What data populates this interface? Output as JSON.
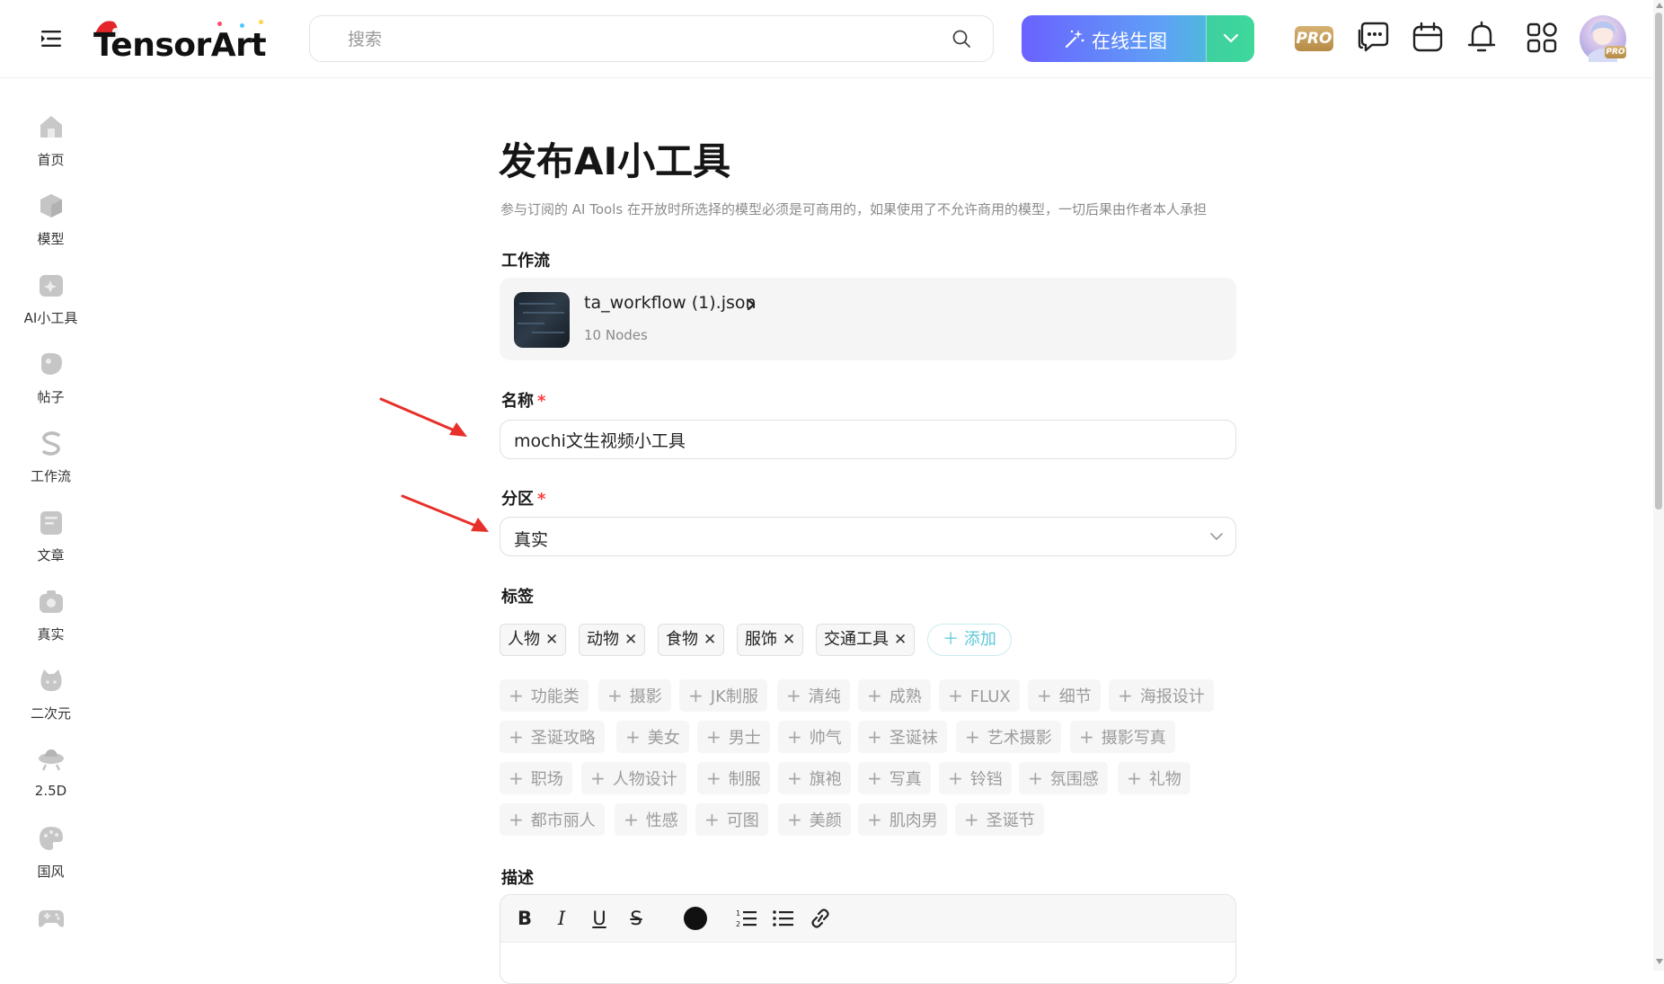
{
  "header": {
    "logo_text": "TensorArt",
    "search_placeholder": "搜索",
    "generate_label": "在线生图",
    "pro_label": "PRO",
    "avatar_pro_label": "PRO"
  },
  "sidebar": {
    "items": [
      {
        "label": "首页",
        "icon": "home-icon"
      },
      {
        "label": "模型",
        "icon": "cube-icon"
      },
      {
        "label": "AI小工具",
        "icon": "ai-tools-icon"
      },
      {
        "label": "帖子",
        "icon": "post-icon"
      },
      {
        "label": "工作流",
        "icon": "workflow-icon"
      },
      {
        "label": "文章",
        "icon": "article-icon"
      },
      {
        "label": "真实",
        "icon": "camera-icon"
      },
      {
        "label": "二次元",
        "icon": "anime-icon"
      },
      {
        "label": "2.5D",
        "icon": "ufo-icon"
      },
      {
        "label": "国风",
        "icon": "palette-icon"
      },
      {
        "label": "",
        "icon": "gamepad-icon"
      }
    ]
  },
  "page": {
    "title": "发布AI小工具",
    "subtitle": "参与订阅的 AI Tools 在开放时所选择的模型必须是可商用的，如果使用了不允许商用的模型，一切后果由作者本人承担"
  },
  "workflow": {
    "label": "工作流",
    "file_name": "ta_workflow (1).json",
    "nodes": "10 Nodes"
  },
  "name_field": {
    "label": "名称",
    "required": "*",
    "value": "mochi文生视频小工具"
  },
  "category_field": {
    "label": "分区",
    "required": "*",
    "value": "真实"
  },
  "tags": {
    "label": "标签",
    "selected": [
      "人物",
      "动物",
      "食物",
      "服饰",
      "交通工具"
    ],
    "add_label": "添加",
    "suggestions": [
      [
        "功能类",
        "摄影",
        "JK制服",
        "清纯",
        "成熟",
        "FLUX",
        "细节",
        "海报设计"
      ],
      [
        "圣诞攻略",
        "美女",
        "男士",
        "帅气",
        "圣诞袜",
        "艺术摄影",
        "摄影写真"
      ],
      [
        "职场",
        "人物设计",
        "制服",
        "旗袍",
        "写真",
        "铃铛",
        "氛围感",
        "礼物"
      ],
      [
        "都市丽人",
        "性感",
        "可图",
        "美颜",
        "肌肉男",
        "圣诞节"
      ]
    ]
  },
  "description": {
    "label": "描述",
    "toolbar": [
      "bold-icon",
      "italic-icon",
      "underline-icon",
      "strikethrough-icon",
      "text-color-icon",
      "ordered-list-icon",
      "bullet-list-icon",
      "link-icon"
    ]
  },
  "colors": {
    "accent_start": "#6a62ff",
    "accent_end": "#3ed2c2",
    "required": "#ff3b3b",
    "annotation_arrow": "#e8302a"
  }
}
